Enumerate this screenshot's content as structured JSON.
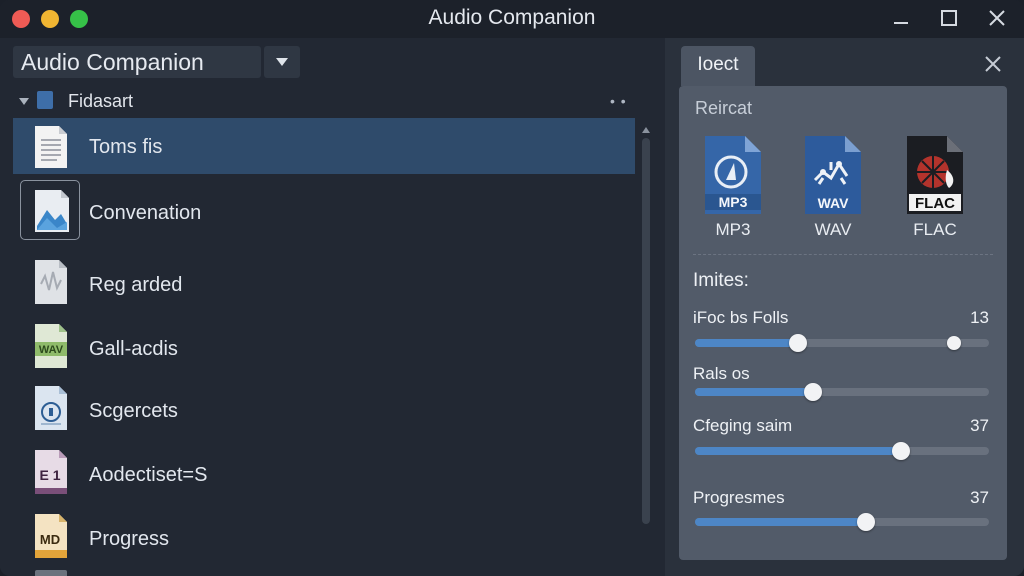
{
  "window": {
    "title": "Audio Companion"
  },
  "left": {
    "selector_value": "Audio Companion",
    "tree_label": "Fidasart",
    "files": [
      {
        "label": "Toms fis",
        "icon": "document-icon",
        "selected": true
      },
      {
        "label": "Convenation",
        "icon": "image-file-icon",
        "selected": false
      },
      {
        "label": "Reg arded",
        "icon": "audio-file-icon",
        "selected": false
      },
      {
        "label": "Gall-acdis",
        "icon": "wav-file-icon",
        "badge": "WAV",
        "selected": false
      },
      {
        "label": "Scgercets",
        "icon": "circle-file-icon",
        "selected": false
      },
      {
        "label": "Aodectiset=S",
        "icon": "e1-file-icon",
        "badge": "E 1",
        "selected": false
      },
      {
        "label": "Progress",
        "icon": "md-file-icon",
        "badge": "MD",
        "selected": false
      }
    ]
  },
  "right": {
    "tab_label": "Ioect",
    "section_title": "Reircat",
    "formats": [
      {
        "label": "MP3",
        "badge": "MP3",
        "color": "#3566a8"
      },
      {
        "label": "WAV",
        "badge": "WAV",
        "color": "#2d5b9c"
      },
      {
        "label": "FLAC",
        "badge": "FLAC",
        "color": "#1b1d22"
      }
    ],
    "limits_title": "Imites:",
    "sliders": [
      {
        "label": "iFoc bs Folls",
        "value": "13",
        "level": 0.35,
        "secondary": 0.88
      },
      {
        "label": "Rals os",
        "value": "",
        "level": 0.4
      },
      {
        "label": "Cfeging saim",
        "value": "37",
        "level": 0.7
      },
      {
        "label": "Progresmes",
        "value": "37",
        "level": 0.58
      }
    ]
  },
  "colors": {
    "accent": "#4d86c6",
    "selection": "#2f4b6b"
  }
}
